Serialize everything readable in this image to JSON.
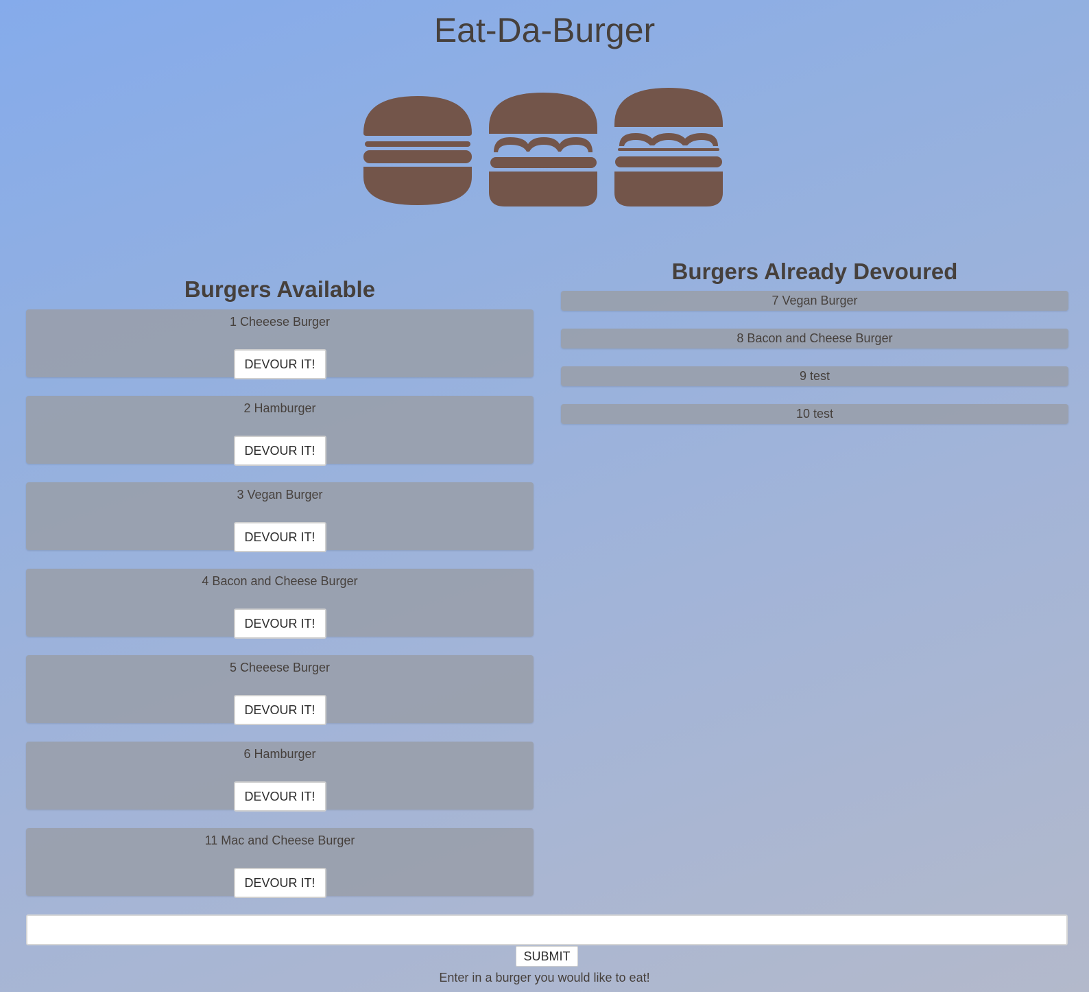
{
  "header": {
    "title": "Eat-Da-Burger"
  },
  "logo": {
    "icon": "burger-trio-icon",
    "color": "#73554a"
  },
  "available": {
    "heading": "Burgers Available",
    "button_label": "DEVOUR IT!",
    "items": [
      {
        "label": "1 Cheeese Burger"
      },
      {
        "label": "2 Hamburger"
      },
      {
        "label": "3 Vegan Burger"
      },
      {
        "label": "4 Bacon and Cheese Burger"
      },
      {
        "label": "5 Cheeese Burger"
      },
      {
        "label": "6 Hamburger"
      },
      {
        "label": "11 Mac and Cheese Burger"
      }
    ]
  },
  "devoured": {
    "heading": "Burgers Already Devoured",
    "items": [
      {
        "label": "7 Vegan Burger"
      },
      {
        "label": "8 Bacon and Cheese Burger"
      },
      {
        "label": "9 test"
      },
      {
        "label": "10 test"
      }
    ]
  },
  "form": {
    "input_value": "",
    "submit_label": "SUBMIT",
    "hint": "Enter in a burger you would like to eat!"
  }
}
